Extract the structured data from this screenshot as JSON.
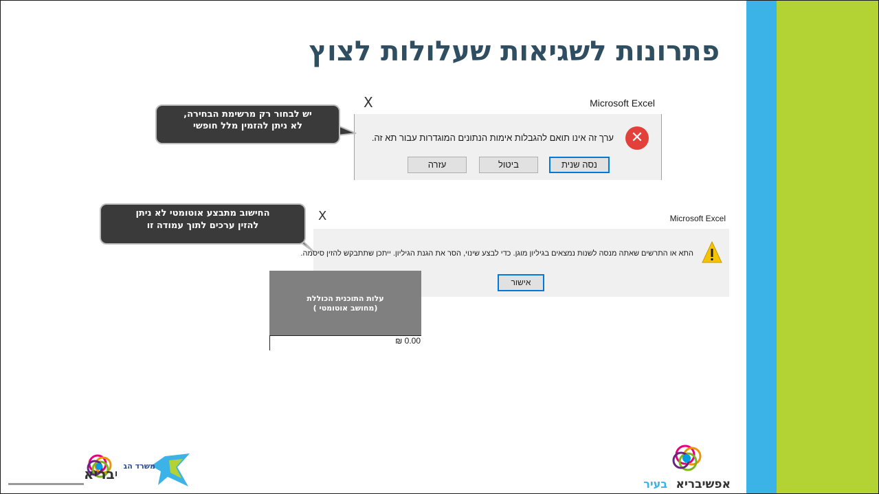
{
  "slide": {
    "title": "פתרונות לשגיאות שעלולות לצוץ"
  },
  "dialog_validation": {
    "app_name": "Microsoft Excel",
    "close_glyph": "X",
    "message": "ערך זה אינו תואם להגבלות אימות הנתונים המוגדרות עבור תא זה.",
    "buttons": [
      "נסה שנית",
      "ביטול",
      "עזרה"
    ],
    "icon": "error-icon"
  },
  "callout_validation": {
    "line1": "יש לבחור רק מרשימת הבחירה,",
    "line2": "לא ניתן להזמין מלל חופשי"
  },
  "callout_protected": {
    "line1": "החישוב מתבצע אוטומטי  לא ניתן",
    "line2": "להזין ערכים לתוך עמודה זו"
  },
  "dialog_protected": {
    "app_name": "Microsoft Excel",
    "close_glyph": "X",
    "message": "התא או התרשים שאתה מנסה לשנות נמצאים בגיליון מוגן. כדי לבצע שינוי, הסר את הגנת הגיליון. ייתכן שתתבקש להזין סיסמה.",
    "ok_label": "אישור",
    "icon": "warning-icon"
  },
  "cell": {
    "header_line1": "עלות התוכנית הכוללת",
    "header_line2": "(מחושב אוטומטי )",
    "value": "0.00 ₪"
  },
  "logos": {
    "left_brand": "אפשיבריא",
    "ministry": "משרד הבריאות",
    "right_brand": "אפשיבריא",
    "right_brand_suffix": "בעיר"
  },
  "colors": {
    "title": "#2f4e61",
    "stripe_blue": "#3cb3e6",
    "stripe_green": "#b3d335",
    "callout_bg": "#3a3a3a",
    "cell_header": "#808080"
  }
}
